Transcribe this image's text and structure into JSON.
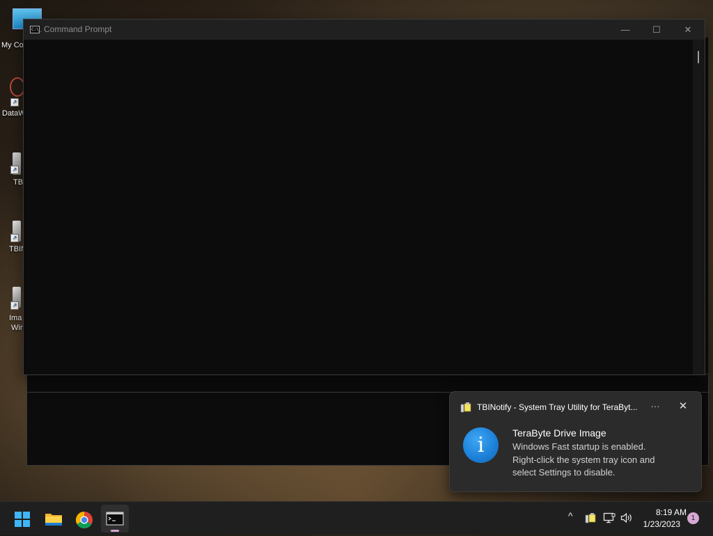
{
  "desktop": {
    "icons": [
      {
        "label": "My Co",
        "icon": "computer-icon"
      },
      {
        "label": "DataW",
        "icon": "datawave-icon"
      },
      {
        "label": "TBI",
        "icon": "tbi-icon"
      },
      {
        "label": "TBIN",
        "icon": "tbinotify-icon"
      },
      {
        "label": "Ima",
        "label2": "Win",
        "icon": "image-for-windows-icon"
      }
    ]
  },
  "cmd_window": {
    "title": "Command Prompt",
    "app_icon": "cmd-icon",
    "icon_text": "C:\\_",
    "buttons": {
      "minimize": "—",
      "maximize": "☐",
      "close": "✕"
    }
  },
  "toast": {
    "header": "TBINotify - System Tray Utility for TeraByt...",
    "more_label": "···",
    "close_label": "✕",
    "icon": "info-icon",
    "info_glyph": "i",
    "title": "TeraByte Drive Image",
    "body_lines": [
      "Windows Fast startup is enabled.",
      "Right-click the system tray icon and",
      "select Settings to disable."
    ]
  },
  "taskbar": {
    "items": [
      "start-icon",
      "file-explorer-icon",
      "chrome-icon",
      "command-prompt-icon"
    ],
    "tray": {
      "chevron": "^",
      "speaker": "🔊",
      "time": "8:19 AM",
      "date": "1/23/2023",
      "notification_count": "1"
    }
  },
  "colors": {
    "accent": "#1b7fd6",
    "badge": "#d6a8d3",
    "console_bg": "#0c0c0c",
    "titlebar_bg": "#202020",
    "taskbar_bg": "#1f1f1f"
  }
}
